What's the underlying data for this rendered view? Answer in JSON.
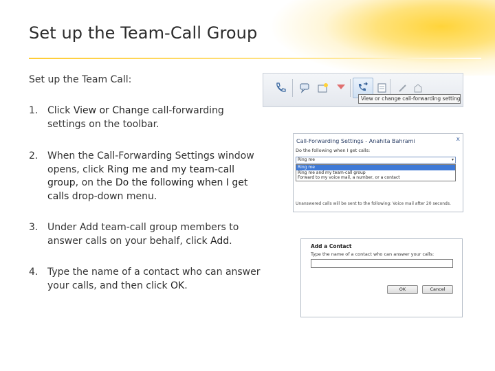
{
  "slide": {
    "title": "Set up the Team-Call Group",
    "intro": "Set up the Team Call:"
  },
  "steps": [
    {
      "num": "1.",
      "parts": [
        "Click ",
        "View or Change",
        " call-forwarding settings on the toolbar."
      ]
    },
    {
      "num": "2.",
      "parts": [
        "When the Call-Forwarding Settings window opens, click ",
        "Ring me and my team-call group",
        ", on the ",
        "Do the following when I get calls",
        " drop-down menu."
      ]
    },
    {
      "num": "3.",
      "parts": [
        "Under Add team-call group members to answer calls on your behalf, click ",
        "Add",
        "."
      ]
    },
    {
      "num": "4.",
      "parts": [
        "Type the name of a contact who can answer your calls, and then click ",
        "OK",
        "."
      ]
    }
  ],
  "toolbar_shot": {
    "tooltip": "View or change call-forwarding settings",
    "icons": [
      "phone-icon",
      "chat-icon",
      "star-icon",
      "flag-icon",
      "call-forward-icon",
      "note-icon",
      "pen-icon",
      "shape-icon"
    ]
  },
  "forwarding_shot": {
    "window_title": "Call-Forwarding Settings - Anahita Bahrami",
    "close": "x",
    "label": "Do the following when I get calls:",
    "selected": "Ring me",
    "options": [
      "Ring me",
      "Ring me and my team-call group",
      "Forward to my voice mail, a number, or a contact"
    ],
    "footer": "Unanswered calls will be sent to the following: Voice mail after 20 seconds."
  },
  "contact_shot": {
    "title": "Add a Contact",
    "label": "Type the name of a contact who can answer your calls:",
    "ok": "OK",
    "cancel": "Cancel"
  },
  "colors": {
    "accent_yellow": "#ffcc33",
    "highlight_blue": "#3e79d6"
  }
}
